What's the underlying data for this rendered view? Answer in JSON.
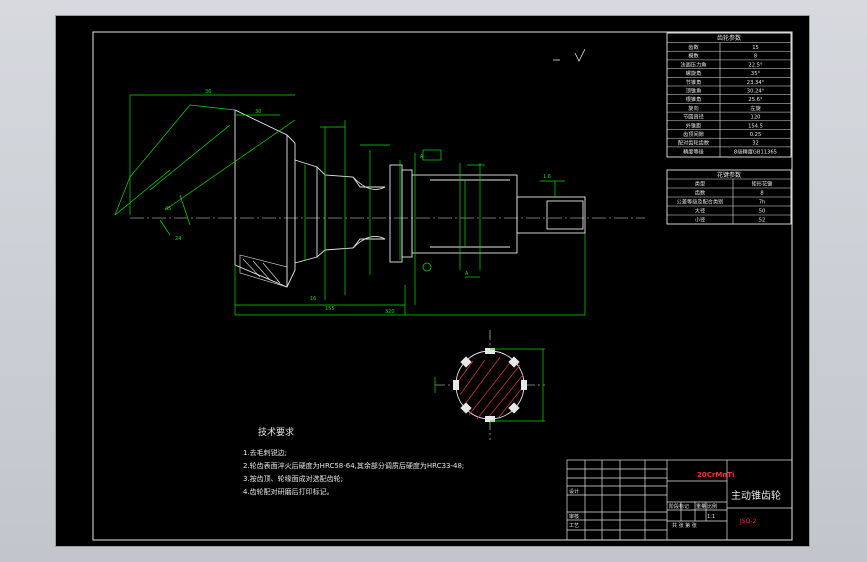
{
  "drawing": {
    "title": "主动锥齿轮",
    "material": "20CrMnTi",
    "drawing_no": "JSQ-2",
    "scale": "1:1",
    "sheet_text": "共 张 第 张"
  },
  "title_block": {
    "labels": {
      "design": "设计",
      "review": "审核",
      "process": "工艺",
      "stage_mark": "阶段标记",
      "weight": "重量",
      "ratio": "比例"
    }
  },
  "tech_req": {
    "heading": "技术要求",
    "items": [
      "1.去毛刺锐边;",
      "2.轮齿表面淬火后硬度为HRC58-64,其余部分调质后硬度为HRC33-48;",
      "3.按齿顶、轮缘面成对选配齿轮;",
      "4.齿轮配对研磨后打印标记。"
    ]
  },
  "gear_params": {
    "heading": "齿轮参数",
    "rows": [
      {
        "name": "齿数",
        "value": "15"
      },
      {
        "name": "模数",
        "value": "8"
      },
      {
        "name": "法面压力角",
        "value": "22.5°"
      },
      {
        "name": "螺旋角",
        "value": "35°"
      },
      {
        "name": "节锥角",
        "value": "23.34°"
      },
      {
        "name": "顶锥角",
        "value": "30.24°"
      },
      {
        "name": "根锥角",
        "value": "25.6°"
      },
      {
        "name": "旋向",
        "value": "左旋"
      },
      {
        "name": "节圆直径",
        "value": "120"
      },
      {
        "name": "外锥距",
        "value": "154.5"
      },
      {
        "name": "齿顶间隙",
        "value": "0.25"
      },
      {
        "name": "配对齿轮齿数",
        "value": "32"
      },
      {
        "name": "精度等级",
        "value": "8级精度GB11365"
      }
    ]
  },
  "spline_params": {
    "heading": "花键参数",
    "rows": [
      {
        "name": "类型",
        "value": "矩形花键"
      },
      {
        "name": "齿数",
        "value": "8"
      },
      {
        "name": "公差等级及配合类别",
        "value": "7h"
      },
      {
        "name": "大径",
        "value": "50"
      },
      {
        "name": "小径",
        "value": "52"
      }
    ]
  },
  "colors": {
    "line": "#00e000",
    "text": "#e6e6e6",
    "red": "#ff3030",
    "hatch": "#d03030",
    "bg": "#000000"
  }
}
